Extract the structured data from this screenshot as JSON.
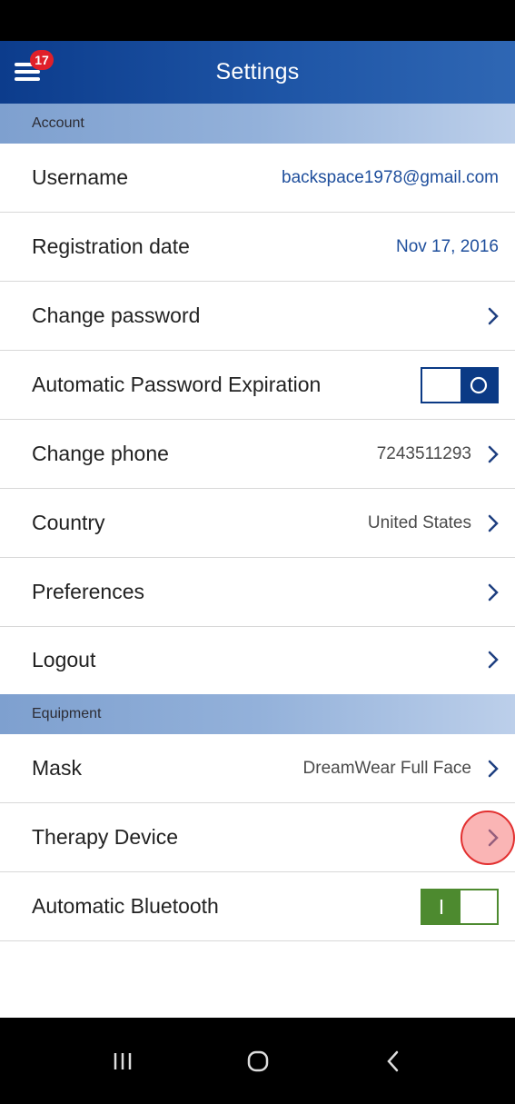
{
  "header": {
    "title": "Settings",
    "notification_count": "17",
    "menu_icon": "hamburger-menu-icon"
  },
  "sections": {
    "account": {
      "label": "Account"
    },
    "equipment": {
      "label": "Equipment"
    }
  },
  "account_rows": {
    "username": {
      "label": "Username",
      "value": "backspace1978@gmail.com"
    },
    "registration_date": {
      "label": "Registration date",
      "value": "Nov 17, 2016"
    },
    "change_password": {
      "label": "Change password"
    },
    "password_expiration": {
      "label": "Automatic Password Expiration",
      "toggle_state": "off",
      "toggle_glyph": "O"
    },
    "change_phone": {
      "label": "Change phone",
      "value": "7243511293"
    },
    "country": {
      "label": "Country",
      "value": "United States"
    },
    "preferences": {
      "label": "Preferences"
    },
    "logout": {
      "label": "Logout"
    }
  },
  "equipment_rows": {
    "mask": {
      "label": "Mask",
      "value": "DreamWear Full Face"
    },
    "therapy_device": {
      "label": "Therapy Device"
    },
    "bluetooth": {
      "label": "Automatic Bluetooth",
      "toggle_state": "on",
      "toggle_glyph": "I"
    }
  },
  "colors": {
    "brand_blue": "#0b3a85",
    "toggle_on_green": "#4d8a2f",
    "value_blue": "#1e4e9c",
    "badge_red": "#e0202a"
  },
  "system_nav": {
    "recents_icon": "recents-icon",
    "home_icon": "home-icon",
    "back_icon": "back-icon"
  }
}
